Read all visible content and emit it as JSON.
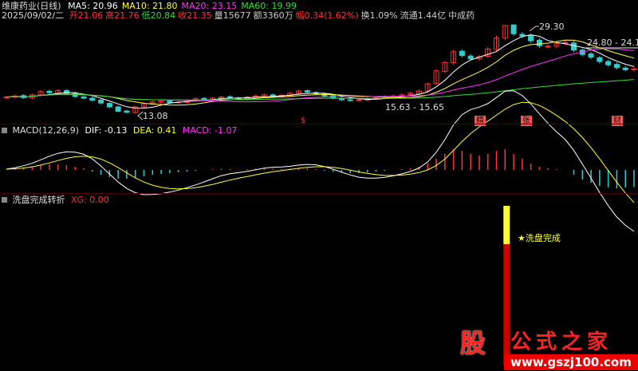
{
  "header": {
    "stock_name": "维康药业(日线)",
    "date": "2025/09/02/二",
    "ma": [
      {
        "label": "MA5: 20.96",
        "color": "#ffffff"
      },
      {
        "label": "MA10: 21.80",
        "color": "#ffff33"
      },
      {
        "label": "MA20: 23.15",
        "color": "#ff33ff"
      },
      {
        "label": "MA60: 19.99",
        "color": "#33dd33"
      }
    ],
    "quote": [
      {
        "label": "开21.06",
        "color": "#ff3333"
      },
      {
        "label": "高21.76",
        "color": "#ff3333"
      },
      {
        "label": "低20.84",
        "color": "#33dd33"
      },
      {
        "label": "收21.35",
        "color": "#ff3333"
      },
      {
        "label": "量15677",
        "color": "#cccccc"
      },
      {
        "label": "额3360万",
        "color": "#cccccc"
      },
      {
        "label": "幅0.34(1.62%)",
        "color": "#ff3333"
      },
      {
        "label": "换1.09%",
        "color": "#cccccc"
      },
      {
        "label": "流通1.44亿",
        "color": "#cccccc"
      },
      {
        "label": "中成药",
        "color": "#cccccc"
      }
    ]
  },
  "main_chart": {
    "annotations": {
      "high": "29.30",
      "low": "13.08",
      "range_right": "24.80 - 24.14",
      "range_mid": "15.63 - 15.65"
    },
    "event_marks": [
      "$",
      "精",
      "张",
      "财"
    ]
  },
  "macd_panel": {
    "title": "MACD(12,26,9)",
    "dif": "DIF: -0.13",
    "dea": "DEA: 0.41",
    "macd": "MACD: -1.07"
  },
  "xg_panel": {
    "title": "洗盘完成转折",
    "xg": "XG: 0.00",
    "signal_label": "洗盘完成",
    "star": "★"
  },
  "watermark": {
    "logo_char": "股",
    "brand": "公式之家",
    "url": "www.gszj100.com"
  },
  "chart_data": [
    {
      "type": "candlestick",
      "title": "维康药业(日线)",
      "y_range": [
        13.08,
        29.3
      ],
      "price_series": [
        16.2,
        16.4,
        16.1,
        16.6,
        17.2,
        17.0,
        17.4,
        16.9,
        16.3,
        16.0,
        15.6,
        15.1,
        14.4,
        13.6,
        13.4,
        14.4,
        15.0,
        15.3,
        15.5,
        15.2,
        15.3,
        15.6,
        15.9,
        15.8,
        16.0,
        16.2,
        16.1,
        15.9,
        16.2,
        16.4,
        16.6,
        16.4,
        16.5,
        16.9,
        17.3,
        17.1,
        16.8,
        16.4,
        16.0,
        15.7,
        15.6,
        15.7,
        15.9,
        16.1,
        16.3,
        16.4,
        16.6,
        16.9,
        17.3,
        18.6,
        21.0,
        22.5,
        24.5,
        23.8,
        23.2,
        23.6,
        25.0,
        27.0,
        29.3,
        27.8,
        27.4,
        26.5,
        25.6,
        25.5,
        26.0,
        26.2,
        24.8,
        24.0,
        23.5,
        22.7,
        22.1,
        21.6,
        21.2,
        21.35
      ],
      "ma": [
        {
          "name": "MA5",
          "last": 20.96
        },
        {
          "name": "MA10",
          "last": 21.8
        },
        {
          "name": "MA20",
          "last": 23.15
        },
        {
          "name": "MA60",
          "last": 19.99
        }
      ]
    },
    {
      "type": "bar",
      "title": "MACD(12,26,9)",
      "dif_last": -0.13,
      "dea_last": 0.41,
      "macd_last": -1.07,
      "hist": [
        0.05,
        0.1,
        0.15,
        0.2,
        0.3,
        0.35,
        0.35,
        0.3,
        0.2,
        0.1,
        -0.1,
        -0.3,
        -0.45,
        -0.55,
        -0.55,
        -0.5,
        -0.4,
        -0.3,
        -0.25,
        -0.2,
        -0.15,
        -0.1,
        -0.05,
        0,
        0.05,
        0.08,
        0.05,
        0.02,
        0.05,
        0.08,
        0.1,
        0.08,
        0.05,
        0.08,
        0.12,
        0.1,
        0.05,
        -0.05,
        -0.12,
        -0.18,
        -0.2,
        -0.2,
        -0.15,
        -0.1,
        -0.05,
        0,
        0.05,
        0.1,
        0.2,
        0.4,
        0.7,
        1.0,
        1.3,
        1.2,
        1.0,
        0.9,
        1.0,
        1.2,
        1.3,
        1.0,
        0.7,
        0.4,
        0.2,
        0.1,
        0.05,
        0,
        -0.3,
        -0.6,
        -0.8,
        -1.0,
        -1.1,
        -1.15,
        -1.1,
        -1.07
      ]
    },
    {
      "type": "bar",
      "title": "洗盘完成转折",
      "xg_last": 0.0,
      "signal_index": 58
    }
  ]
}
